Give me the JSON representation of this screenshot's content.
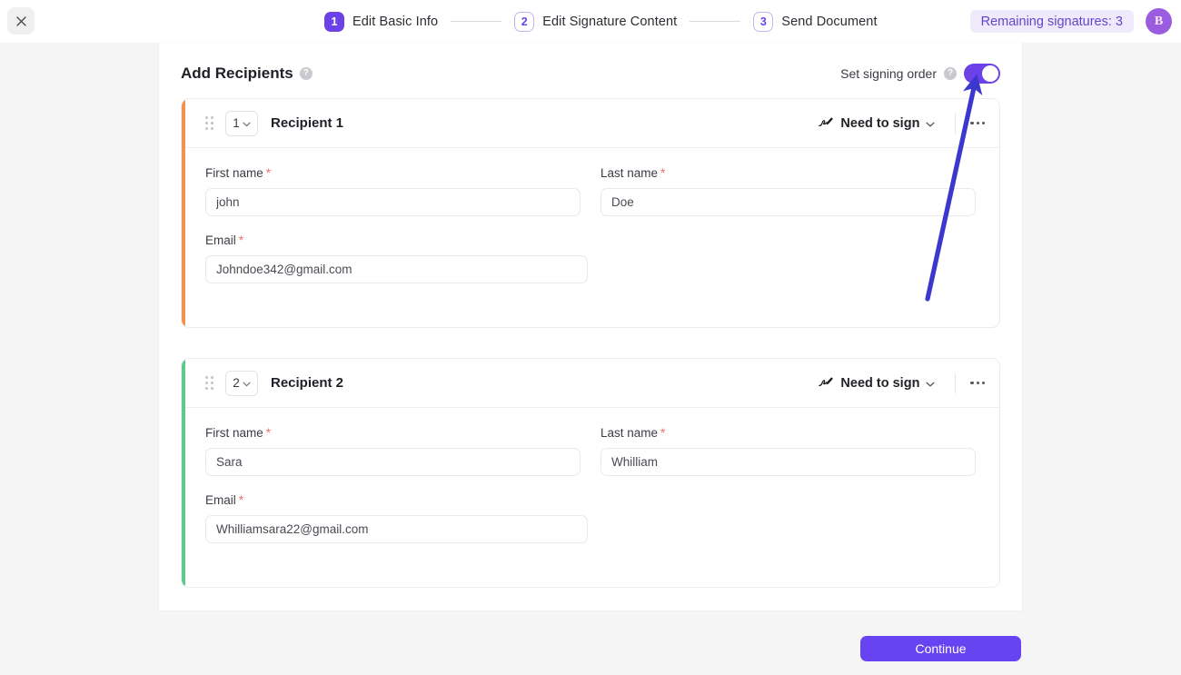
{
  "topbar": {
    "close_icon": "close-icon",
    "steps": [
      {
        "num": "1",
        "label": "Edit Basic Info",
        "state": "active"
      },
      {
        "num": "2",
        "label": "Edit Signature Content",
        "state": "idle"
      },
      {
        "num": "3",
        "label": "Send Document",
        "state": "idle"
      }
    ],
    "remaining_badge": "Remaining signatures: 3",
    "avatar_initial": "B"
  },
  "panel": {
    "title": "Add Recipients",
    "title_help_icon": "help-circle-icon",
    "signing_order_label": "Set signing order",
    "signing_order_help_icon": "help-circle-icon",
    "signing_order_on": true
  },
  "recipients": [
    {
      "order": "1",
      "title": "Recipient 1",
      "accent_color": "#f19350",
      "role_label": "Need to sign",
      "role_icon": "signature-pen-icon",
      "fields": {
        "first_name_label": "First name",
        "first_name_value": "john",
        "last_name_label": "Last name",
        "last_name_value": "Doe",
        "email_label": "Email",
        "email_value": "Johndoe342@gmail.com"
      }
    },
    {
      "order": "2",
      "title": "Recipient 2",
      "accent_color": "#5ec98a",
      "role_label": "Need to sign",
      "role_icon": "signature-pen-icon",
      "fields": {
        "first_name_label": "First name",
        "first_name_value": "Sara",
        "last_name_label": "Last name",
        "last_name_value": "Whilliam",
        "email_label": "Email",
        "email_value": "Whilliamsara22@gmail.com"
      }
    }
  ],
  "footer": {
    "continue_label": "Continue"
  },
  "annotation": {
    "arrow_color": "#3b37cf",
    "points_at": "set-signing-order-toggle"
  },
  "colors": {
    "accent_purple": "#6c42e8",
    "button_purple": "#6843f2",
    "badge_bg": "#eeeafc",
    "page_bg": "#f5f5f5",
    "required_red": "#f26d6d"
  }
}
